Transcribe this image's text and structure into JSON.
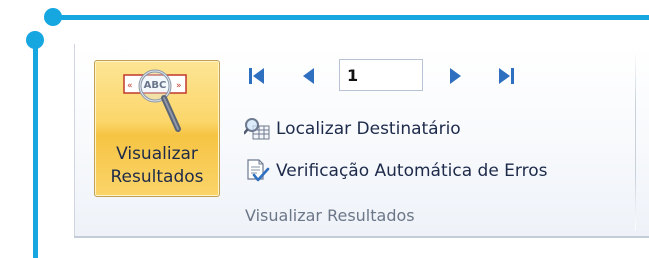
{
  "preview_button": {
    "label_line1": "Visualizar",
    "label_line2": "Resultados",
    "icon_text": "ABC",
    "icon": "magnifier-abc-icon"
  },
  "navigation": {
    "first_icon": "first-record-icon",
    "prev_icon": "previous-record-icon",
    "record_value": "1",
    "next_icon": "next-record-icon",
    "last_icon": "last-record-icon"
  },
  "find_recipient": {
    "label": "Localizar Destinatário",
    "icon": "find-recipient-icon"
  },
  "auto_check": {
    "label": "Verificação Automática de Erros",
    "icon": "check-errors-icon"
  },
  "group": {
    "label": "Visualizar Resultados"
  },
  "colors": {
    "accent_line": "#16a6e0",
    "active_button": "#fbd66a",
    "nav_arrows": "#2f6fc0"
  }
}
